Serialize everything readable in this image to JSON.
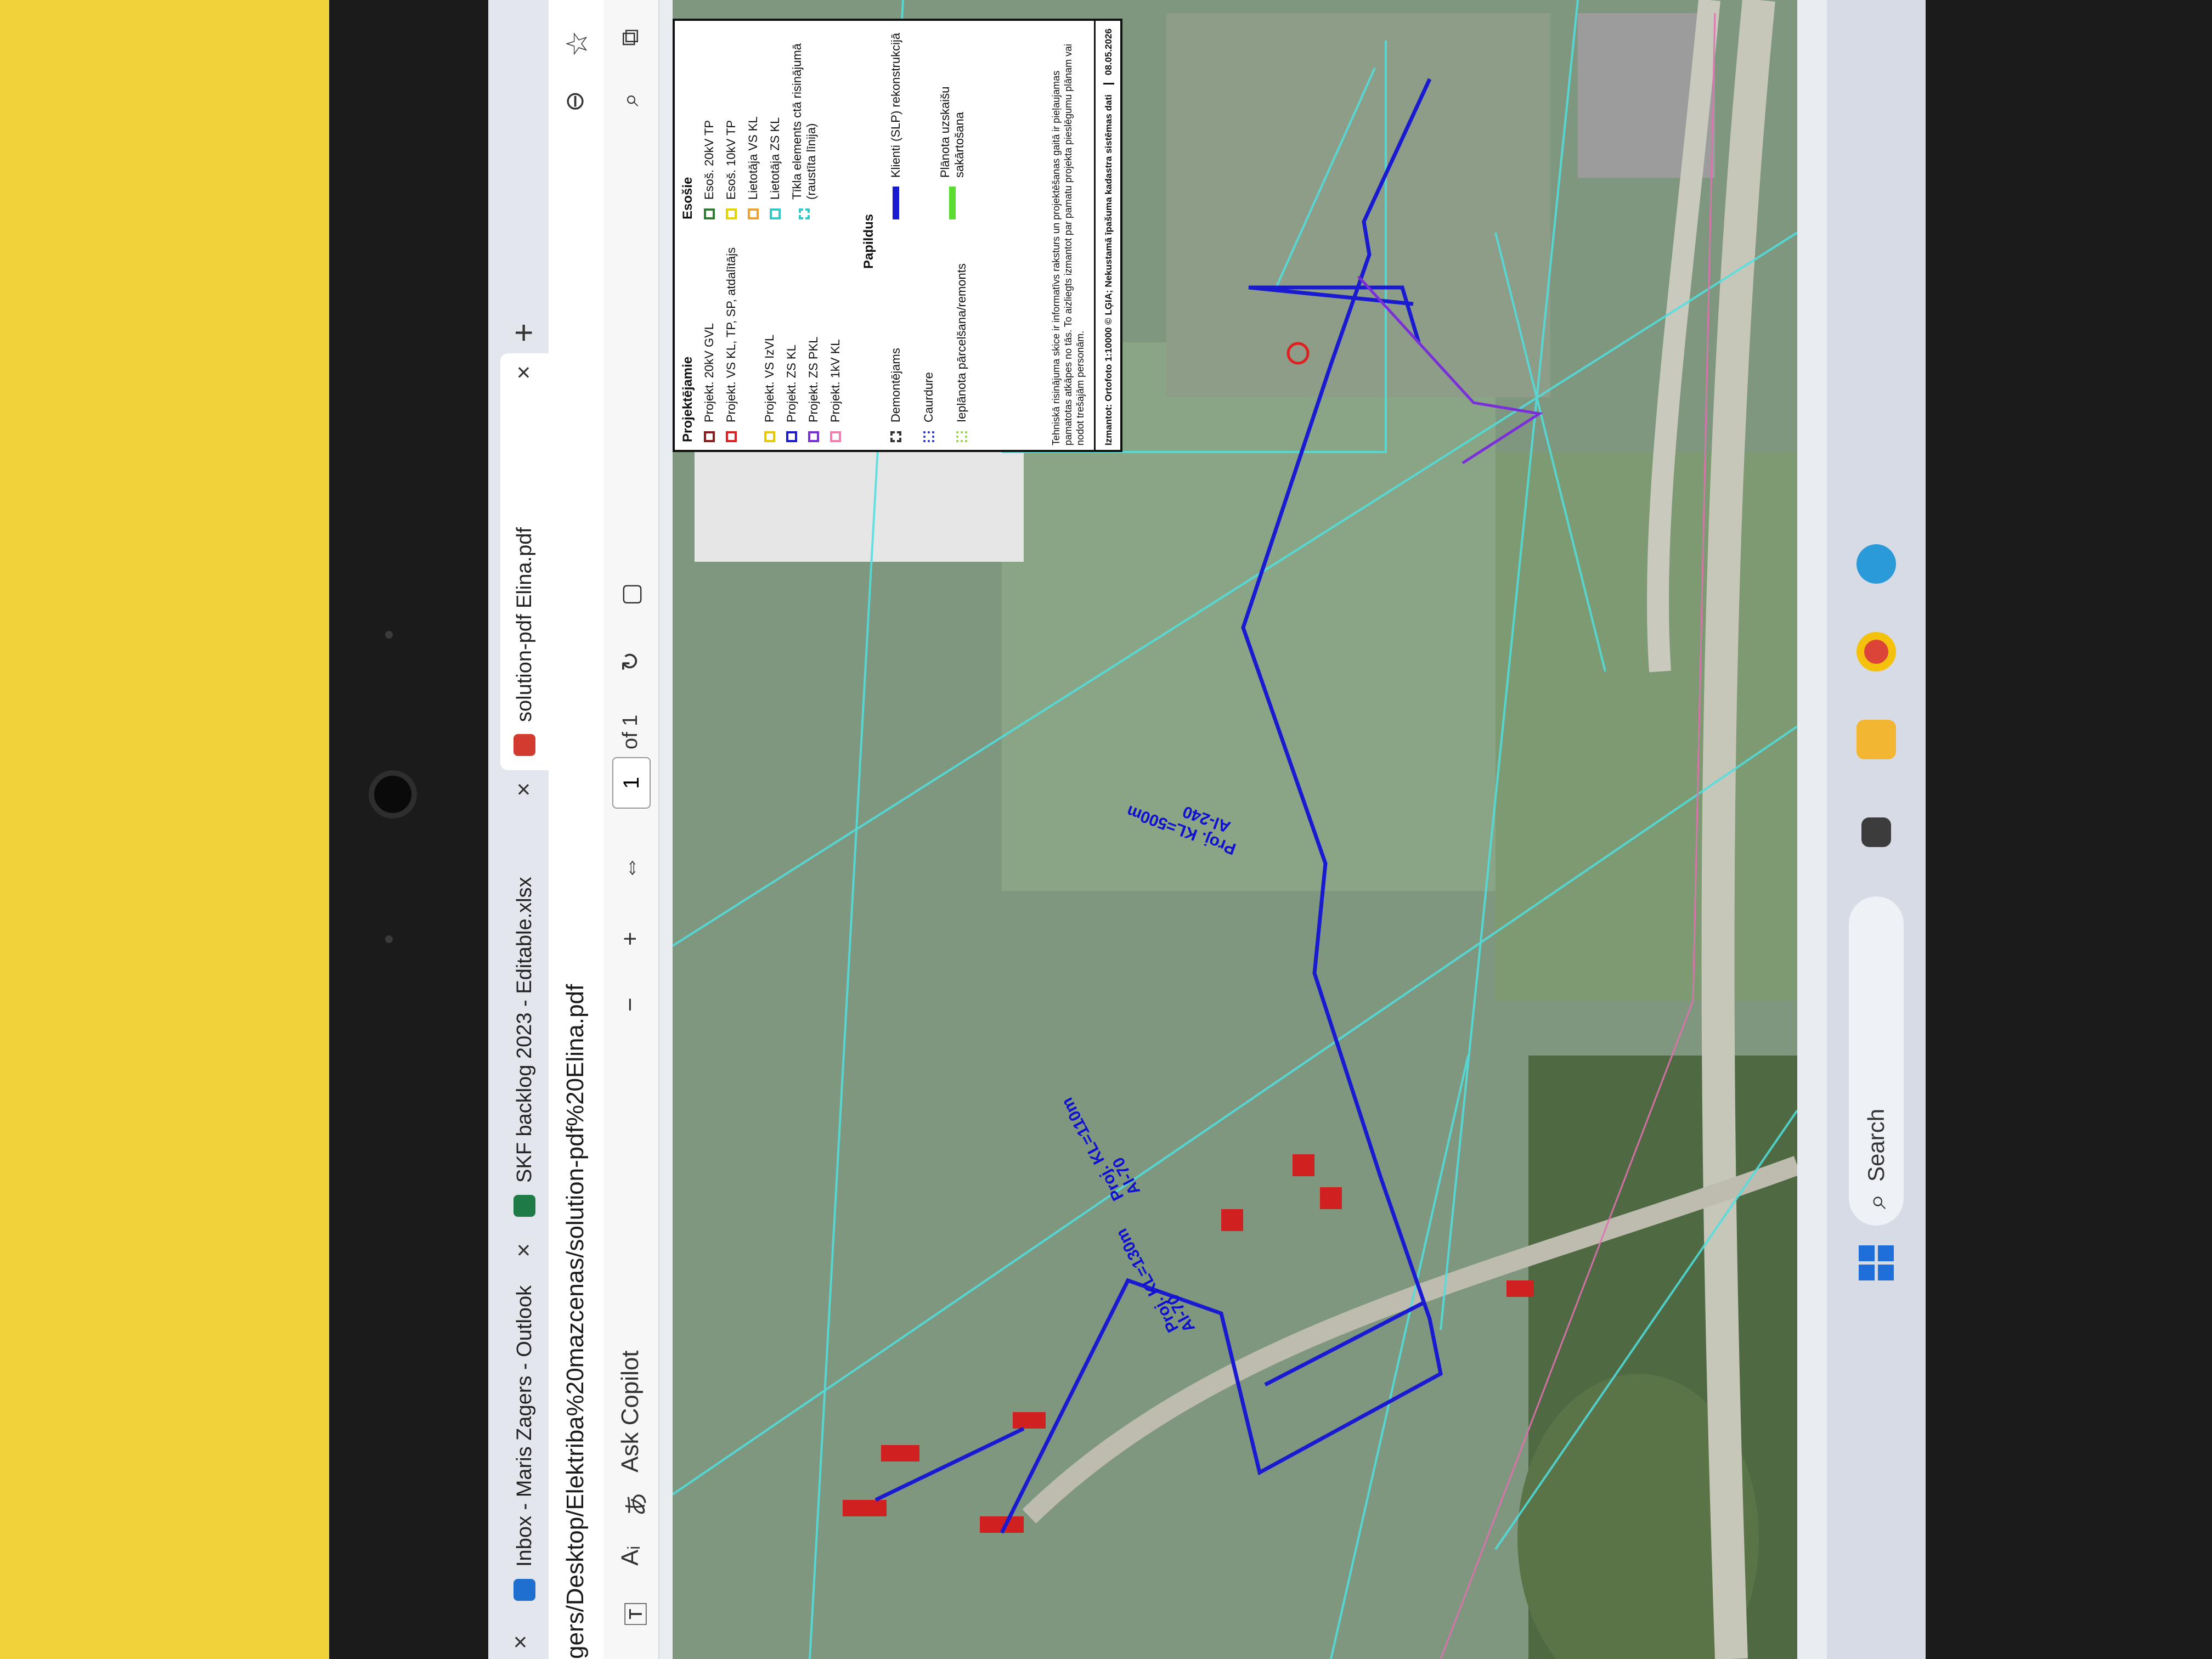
{
  "tabs": [
    {
      "label": "Inbox - Maris Zagers - Outlook",
      "close": "×",
      "icon_color": "#1f6fd1"
    },
    {
      "label": "SKF backlog 2023 - Editable.xlsx",
      "close": "×",
      "icon_color": "#1e7b45"
    },
    {
      "label": "solution-pdf Elina.pdf",
      "close": "×",
      "icon_color": "#d23b2f"
    }
  ],
  "window": {
    "close_glyph": "×",
    "new_tab_glyph": "+"
  },
  "address": {
    "url": "gers/Desktop/Elektriba%20mazcenas/solution-pdf%20Elina.pdf",
    "star_icon": "star-icon",
    "zoom_icon": "zoom-icon"
  },
  "pdf_toolbar": {
    "ask_copilot": "Ask Copilot",
    "minus": "−",
    "plus": "+",
    "page_current": "1",
    "page_count": "of 1"
  },
  "legend": {
    "existing_head": "Esošie",
    "existing": [
      {
        "label": "Esoš. 20kV TP",
        "color": "#2e7d32"
      },
      {
        "label": "Esoš. 10kV TP",
        "color": "#e6d400"
      },
      {
        "label": "Lietotāja VS KL",
        "color": "#f0a030"
      },
      {
        "label": "Lietotāja ZS KL",
        "color": "#33c9c9"
      },
      {
        "label": "Tīkla elements ctā risinājumā (raustīta līnija)",
        "color": "#33c9c9"
      }
    ],
    "projected_head": "Projektējamie",
    "projected": [
      {
        "label": "Projekt. 20kV GVL",
        "color": "#8b1a1a"
      },
      {
        "label": "Projekt. VS KL, TP, SP, atdalītājs",
        "color": "#e02020"
      },
      {
        "label": "Projekt. VS IzVL",
        "color": "#e8c800"
      },
      {
        "label": "Projekt. ZS KL",
        "color": "#1a1ad0"
      },
      {
        "label": "Projekt. ZS PKL",
        "color": "#7b2fd9"
      },
      {
        "label": "Projekt. 1kV KL",
        "color": "#f080b0"
      }
    ],
    "extra_head": "Papildus",
    "extra": [
      {
        "label": "Demontējams",
        "color": "#333333"
      },
      {
        "label": "Caurdure",
        "color": "#2030e0"
      },
      {
        "label": "Ieplānota pārcelšana/remonts",
        "color": "#8fd43a"
      }
    ],
    "clients_label": "Klienti (SLP) rekonstrukcijā",
    "clients_color": "#1a1ad0",
    "planned_label": "Plānota uzskaišu sakārtošana",
    "planned_color": "#5adc30",
    "note": "Tehniskā risinājuma skice ir informatīvs raksturs un projektēšanas gaitā ir pieļaujamas pamatotas atkāpes no tās. To aizliegts izmantot par pamatu projekta pieslēgumu plānam vai nodot trešajām personām.",
    "footer": "Izmantot: Ortofoto 1:10000 © LĢIA; Nekustamā īpašuma kadastra sistēmas dati",
    "date": "08.05.2026"
  },
  "map_labels": [
    {
      "text": "Proj. KL=500m"
    },
    {
      "text": "Al-240"
    },
    {
      "text": "Proj. KL=130m"
    },
    {
      "text": "Al-70"
    },
    {
      "text": "Proj. KL=110m"
    },
    {
      "text": "Al-70"
    }
  ],
  "taskbar": {
    "search_label": "Search",
    "search_icon": "search-icon"
  }
}
